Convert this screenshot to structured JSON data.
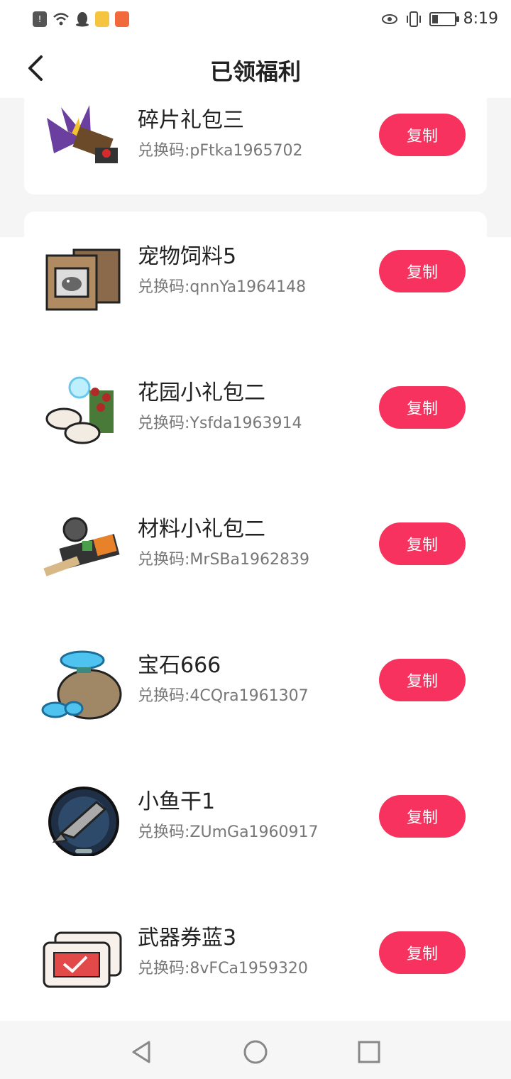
{
  "status_bar": {
    "time": "8:19",
    "left_icons": [
      "alert-icon",
      "wifi-icon",
      "qq-icon",
      "note-icon",
      "app-icon"
    ],
    "right_icons": [
      "eye-icon",
      "vibrate-icon",
      "battery-icon"
    ],
    "battery_level": 0.25
  },
  "header": {
    "title": "已领福利",
    "back_icon": "back-arrow-icon"
  },
  "items": [
    {
      "name": "碎片礼包三",
      "code": "兑换码:pFtka1965702",
      "button": "复制",
      "icon": "fragment-pack-icon"
    },
    {
      "name": "宠物饲料5",
      "code": "兑换码:qnnYa1964148",
      "button": "复制",
      "icon": "pet-food-icon"
    },
    {
      "name": "花园小礼包二",
      "code": "兑换码:Ysfda1963914",
      "button": "复制",
      "icon": "garden-pack-icon"
    },
    {
      "name": "材料小礼包二",
      "code": "兑换码:MrSBa1962839",
      "button": "复制",
      "icon": "material-pack-icon"
    },
    {
      "name": "宝石666",
      "code": "兑换码:4CQra1961307",
      "button": "复制",
      "icon": "gem-bag-icon"
    },
    {
      "name": "小鱼干1",
      "code": "兑换码:ZUmGa1960917",
      "button": "复制",
      "icon": "dried-fish-icon"
    },
    {
      "name": "武器券蓝3",
      "code": "兑换码:8vFCa1959320",
      "button": "复制",
      "icon": "weapon-ticket-icon"
    }
  ],
  "nav_bar": {
    "buttons": [
      "back-triangle-icon",
      "home-circle-icon",
      "recents-square-icon"
    ]
  },
  "colors": {
    "accent": "#f7325e",
    "background": "#f5f5f6"
  }
}
